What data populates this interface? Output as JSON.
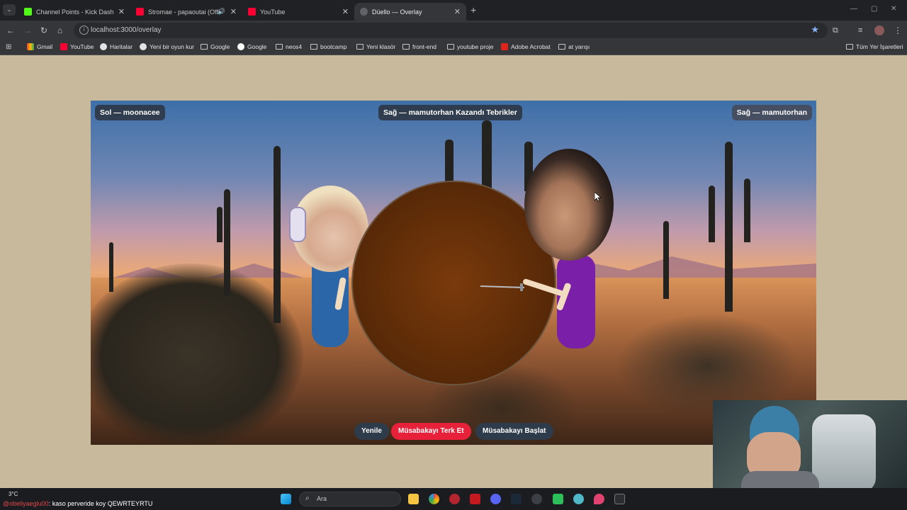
{
  "browser": {
    "tabs": [
      {
        "title": "Channel Points - Kick Dashboard",
        "favicon_color": "#53fc18"
      },
      {
        "title": "Stromae - papaoutai (Official",
        "favicon_color": "#ff0033"
      },
      {
        "title": "YouTube",
        "favicon_color": "#ff0033"
      },
      {
        "title": "Düello — Overlay",
        "favicon_color": "#5f6368"
      }
    ],
    "url": "localhost:3000/overlay",
    "bookmarks": [
      "Gmail",
      "YouTube",
      "Haritalar",
      "Yeni bir oyun kur",
      "Google",
      "Google",
      "neos4",
      "bootcamp",
      "Yeni klasör",
      "front-end",
      "youtube proje",
      "Adobe Acrobat",
      "at yarışı"
    ],
    "all_bookmarks": "Tüm Yer İşaretleri"
  },
  "overlay": {
    "left_label_prefix": "Sol —",
    "left_player": "moonacee",
    "center_label": "Sağ — mamutorhan Kazandı Tebrikler",
    "right_label_prefix": "Sağ —",
    "right_player": "mamutorhan",
    "buttons": {
      "refresh": "Yenile",
      "leave": "Müsabakayı Terk Et",
      "start": "Müsabakayı Başlat"
    },
    "colors": {
      "left_fighter": "#2b67a8",
      "right_fighter": "#7a1fa8",
      "leave_button": "#e8213a",
      "neutral_button": "#2e3b4a"
    }
  },
  "taskbar": {
    "temperature": "3°C",
    "chat_user": "@obeliyaeglu00",
    "chat_message": ": kaso perveride koy QEWRTEYRTU",
    "search_placeholder": "Ara"
  }
}
